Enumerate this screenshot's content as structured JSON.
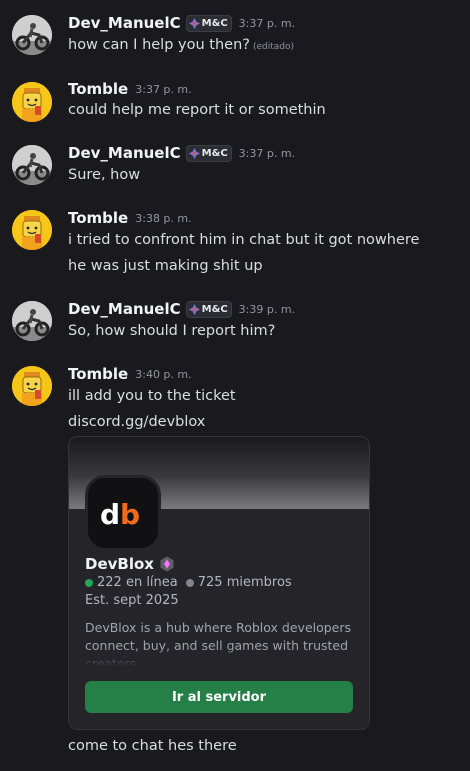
{
  "messages": [
    {
      "author": "Dev_ManuelC",
      "tag": "M&C",
      "time": "3:37 p. m.",
      "lines": [
        "how can I help you then?"
      ],
      "edited": "(editado)"
    },
    {
      "author": "Tomble",
      "time": "3:37 p. m.",
      "lines": [
        "could help me report it or somethin"
      ]
    },
    {
      "author": "Dev_ManuelC",
      "tag": "M&C",
      "time": "3:37 p. m.",
      "lines": [
        "Sure, how"
      ]
    },
    {
      "author": "Tomble",
      "time": "3:38 p. m.",
      "lines": [
        "i tried to confront him in chat but it got nowhere",
        "he was just making shit up"
      ]
    },
    {
      "author": "Dev_ManuelC",
      "tag": "M&C",
      "time": "3:39 p. m.",
      "lines": [
        "So, how should I report him?"
      ]
    },
    {
      "author": "Tomble",
      "time": "3:40 p. m.",
      "lines": [
        "ill add you to the ticket",
        "discord.gg/devblox"
      ]
    }
  ],
  "invite": {
    "icon_text": "db",
    "server_name": "DevBlox",
    "online": "222 en línea",
    "members": "725 miembros",
    "established": "Est. sept 2025",
    "description": "DevBlox is a hub where Roblox developers connect, buy, and sell games with trusted creators",
    "join_label": "Ir al servidor",
    "colors": {
      "join": "#248046",
      "online_dot": "#23a55a",
      "icon_d": "#ffffff",
      "icon_b": "#f26b1d"
    }
  },
  "final_line": "come to chat hes there"
}
